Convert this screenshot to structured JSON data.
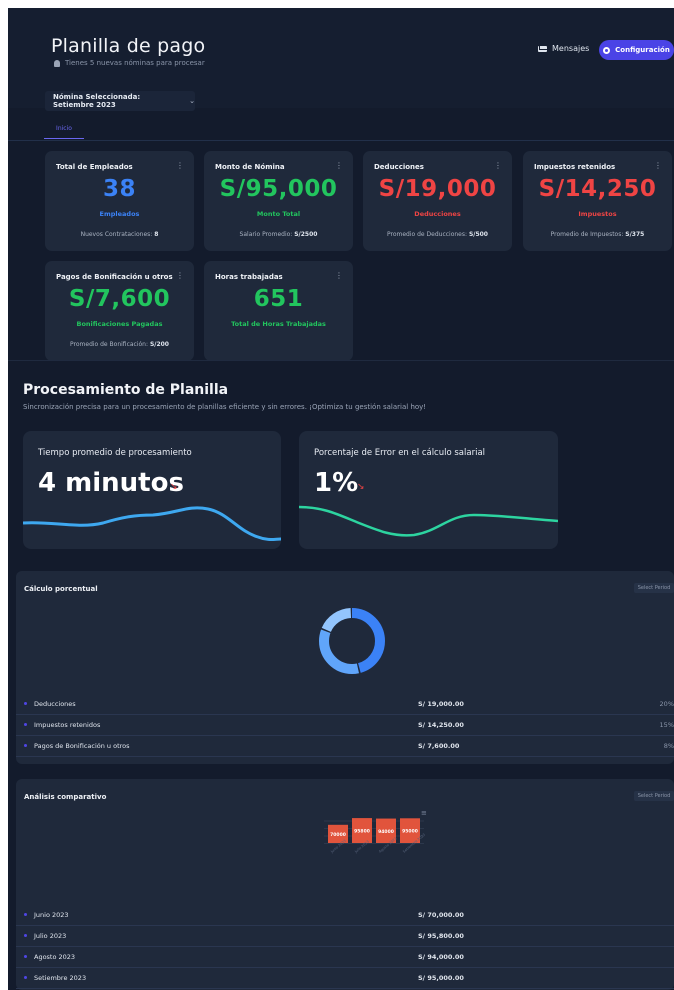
{
  "header": {
    "title": "Planilla de pago",
    "subtitle": "Tienes 5 nuevas nóminas para procesar",
    "messages_label": "Mensajes",
    "config_label": "Configuración"
  },
  "nomina_select": {
    "label": "Nómina Seleccionada: Setiembre 2023"
  },
  "tabs": [
    {
      "label": "Inicio"
    }
  ],
  "cards": [
    {
      "title": "Total de Empleados",
      "value": "38",
      "unit": "Empleados",
      "foot_label": "Nuevos Contrataciones:",
      "foot_value": "8",
      "color": "#3b82f6"
    },
    {
      "title": "Monto de Nómina",
      "value": "S/95,000",
      "unit": "Monto Total",
      "foot_label": "Salario Promedio:",
      "foot_value": "S/2500",
      "color": "#22c55e"
    },
    {
      "title": "Deducciones",
      "value": "S/19,000",
      "unit": "Deducciones",
      "foot_label": "Promedio de Deducciones:",
      "foot_value": "S/500",
      "color": "#ef4444"
    },
    {
      "title": "Impuestos retenidos",
      "value": "S/14,250",
      "unit": "Impuestos",
      "foot_label": "Promedio de Impuestos:",
      "foot_value": "S/375",
      "color": "#ef4444"
    },
    {
      "title": "Pagos de Bonificación u otros",
      "value": "S/7,600",
      "unit": "Bonificaciones Pagadas",
      "foot_label": "Promedio de Bonificación:",
      "foot_value": "S/200",
      "color": "#22c55e"
    },
    {
      "title": "Horas trabajadas",
      "value": "651",
      "unit": "Total de Horas Trabajadas",
      "foot_label": "",
      "foot_value": "",
      "color": "#22c55e"
    }
  ],
  "processing": {
    "title": "Procesamiento de Planilla",
    "subtitle": "Sincronización precisa para un procesamiento de planillas eficiente y sin errores. ¡Optimiza tu gestión salarial hoy!",
    "metrics": [
      {
        "title": "Tiempo promedio de procesamiento",
        "value": "4 minutos",
        "trend_icon": "trend-down-icon",
        "line_color": "#3ea8f0"
      },
      {
        "title": "Porcentaje de Error en el cálculo salarial",
        "value": "1%",
        "trend_icon": "trend-down-icon",
        "line_color": "#2dd4a0"
      }
    ]
  },
  "percent_section": {
    "title": "Cálculo porcentual",
    "period_label": "Select Period",
    "rows": [
      {
        "label": "Deducciones",
        "amount": "S/ 19,000.00",
        "pct": "20%"
      },
      {
        "label": "Impuestos retenidos",
        "amount": "S/ 14,250.00",
        "pct": "15%"
      },
      {
        "label": "Pagos de Bonificación u otros",
        "amount": "S/ 7,600.00",
        "pct": "8%"
      }
    ]
  },
  "comparative_section": {
    "title": "Análisis comparativo",
    "period_label": "Select Period",
    "rows": [
      {
        "label": "Junio 2023",
        "amount": "S/ 70,000.00"
      },
      {
        "label": "Julio 2023",
        "amount": "S/ 95,800.00"
      },
      {
        "label": "Agosto 2023",
        "amount": "S/ 94,000.00"
      },
      {
        "label": "Setiembre 2023",
        "amount": "S/ 95,000.00"
      }
    ]
  },
  "chart_data": [
    {
      "type": "pie",
      "title": "",
      "categories": [
        "Deducciones",
        "Impuestos retenidos",
        "Pagos de Bonificación u otros"
      ],
      "values": [
        20,
        15,
        8
      ],
      "colors": [
        "#3b82f6",
        "#60a5fa",
        "#93c5fd"
      ]
    },
    {
      "type": "bar",
      "title": "",
      "categories": [
        "Junio 2023",
        "Julio 2023",
        "Agosto 2023",
        "Setiembre 2023"
      ],
      "values": [
        70000,
        95800,
        94000,
        95000
      ],
      "data_labels": [
        "70000",
        "95800",
        "94000",
        "95000"
      ],
      "bar_color": "#e1543c"
    }
  ]
}
